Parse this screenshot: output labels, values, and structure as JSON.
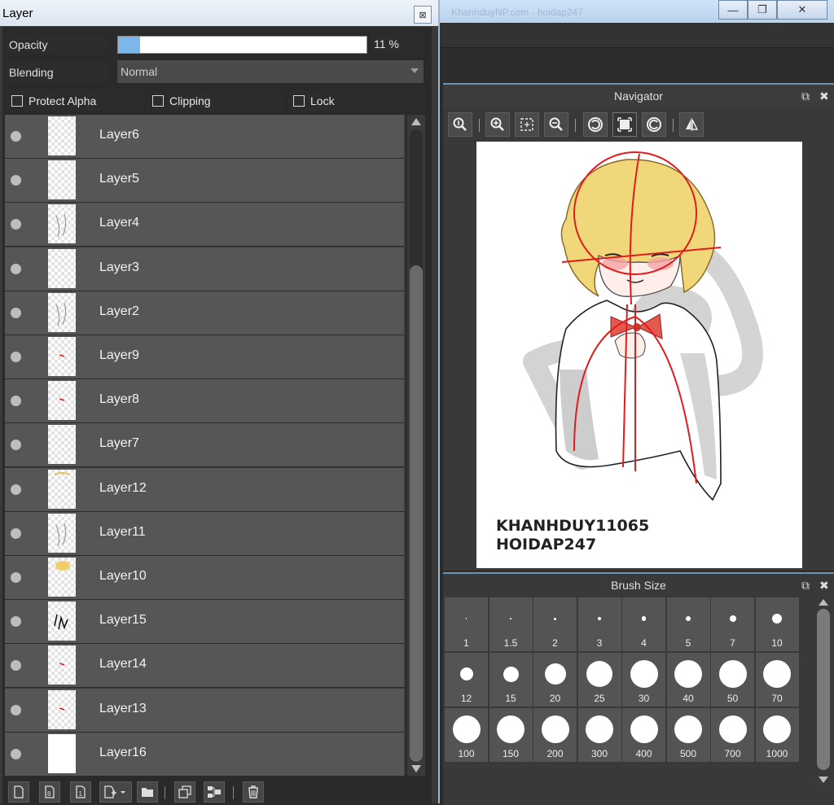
{
  "top_window": {
    "blurred_title": "KhanhduyNP.com - hoidap247",
    "minimize_symbol": "—",
    "restore_symbol": "❐",
    "close_symbol": "✕"
  },
  "layer_window": {
    "title": "Layer",
    "close_symbol": "⊠",
    "opacity_label": "Opacity",
    "opacity_value": "11 %",
    "opacity_fraction": 0.09,
    "blending_label": "Blending",
    "blending_value": "Normal",
    "protect_alpha_label": "Protect Alpha",
    "clipping_label": "Clipping",
    "lock_label": "Lock",
    "layers": [
      {
        "name": "Layer6",
        "thumb": "checker"
      },
      {
        "name": "Layer5",
        "thumb": "checker"
      },
      {
        "name": "Layer4",
        "thumb": "sketch"
      },
      {
        "name": "Layer3",
        "thumb": "checker"
      },
      {
        "name": "Layer2",
        "thumb": "sketch"
      },
      {
        "name": "Layer9",
        "thumb": "red-mark"
      },
      {
        "name": "Layer8",
        "thumb": "red-mark"
      },
      {
        "name": "Layer7",
        "thumb": "checker"
      },
      {
        "name": "Layer12",
        "thumb": "yellow-mark"
      },
      {
        "name": "Layer11",
        "thumb": "sketch"
      },
      {
        "name": "Layer10",
        "thumb": "yellow-blob"
      },
      {
        "name": "Layer15",
        "thumb": "black-sketch"
      },
      {
        "name": "Layer14",
        "thumb": "red-mark"
      },
      {
        "name": "Layer13",
        "thumb": "red-mark"
      },
      {
        "name": "Layer16",
        "thumb": "white"
      }
    ],
    "toolbar_icons": [
      "new-layer-icon",
      "new-8bit-layer-icon",
      "new-1bit-layer-icon",
      "add-layer-dropdown-icon",
      "folder-icon",
      "duplicate-layer-icon",
      "merge-down-icon",
      "delete-layer-icon"
    ]
  },
  "navigator": {
    "title": "Navigator",
    "popout_symbol": "⧉",
    "close_symbol": "✖",
    "buttons": [
      "zoom-actual-icon",
      "zoom-in-icon",
      "fit-icon",
      "zoom-out-icon",
      "rotate-left-icon",
      "reset-view-icon",
      "rotate-right-icon",
      "flip-horizontal-icon"
    ],
    "credit_line1": "KHANHDUY11065",
    "credit_line2": "HOIDAP247"
  },
  "brush_size": {
    "title": "Brush Size",
    "popout_symbol": "⧉",
    "close_symbol": "✖",
    "sizes": [
      "1",
      "1.5",
      "2",
      "3",
      "4",
      "5",
      "7",
      "10",
      "12",
      "15",
      "20",
      "25",
      "30",
      "40",
      "50",
      "70",
      "100",
      "150",
      "200",
      "300",
      "400",
      "500",
      "700",
      "1000"
    ]
  },
  "colors": {
    "accent": "#7db6ea",
    "panel_bg": "#393939",
    "row_bg": "#565656",
    "sketch_red": "#e01c1c",
    "hair_yellow": "#f0d77a"
  }
}
